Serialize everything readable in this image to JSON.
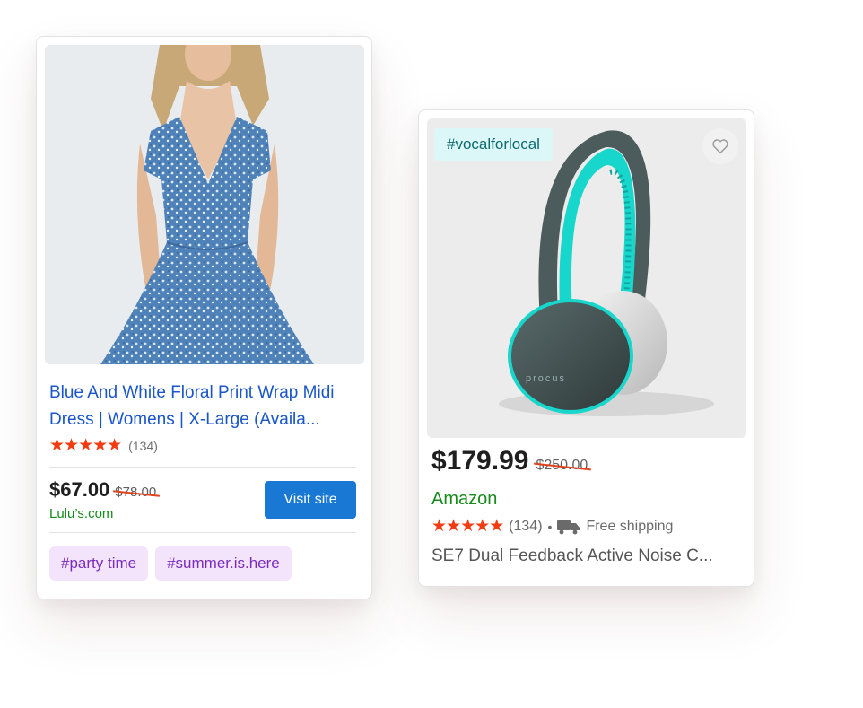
{
  "card1": {
    "title": "Blue And White Floral Print Wrap Midi Dress | Womens | X-Large (Availa...",
    "rating": 5,
    "review_count": "(134)",
    "price": "$67.00",
    "original_price": "$78.00",
    "merchant": "Lulu’s.com",
    "button_label": "Visit site",
    "tags": [
      "#party time",
      "#summer.is.here"
    ]
  },
  "card2": {
    "hashtag": "#vocalforlocal",
    "price": "$179.99",
    "original_price": "$250.00",
    "merchant": "Amazon",
    "rating": 5,
    "review_count": "(134)",
    "separator": "•",
    "shipping": "Free shipping",
    "title": "SE7 Dual Feedback Active Noise C...",
    "headphone_brand": "procus"
  },
  "colors": {
    "link_blue": "#1a55c9",
    "star_red": "#f23b10",
    "button_blue": "#1978d4",
    "merchant_green": "#168a1a",
    "tag_purple_bg": "#f3e4fb",
    "tag_purple_text": "#7a2cbd",
    "hashtag_bg": "#dcf7f8",
    "headphone_teal": "#17d6cc"
  },
  "icons": [
    "heart-icon",
    "truck-icon",
    "star-icon"
  ]
}
